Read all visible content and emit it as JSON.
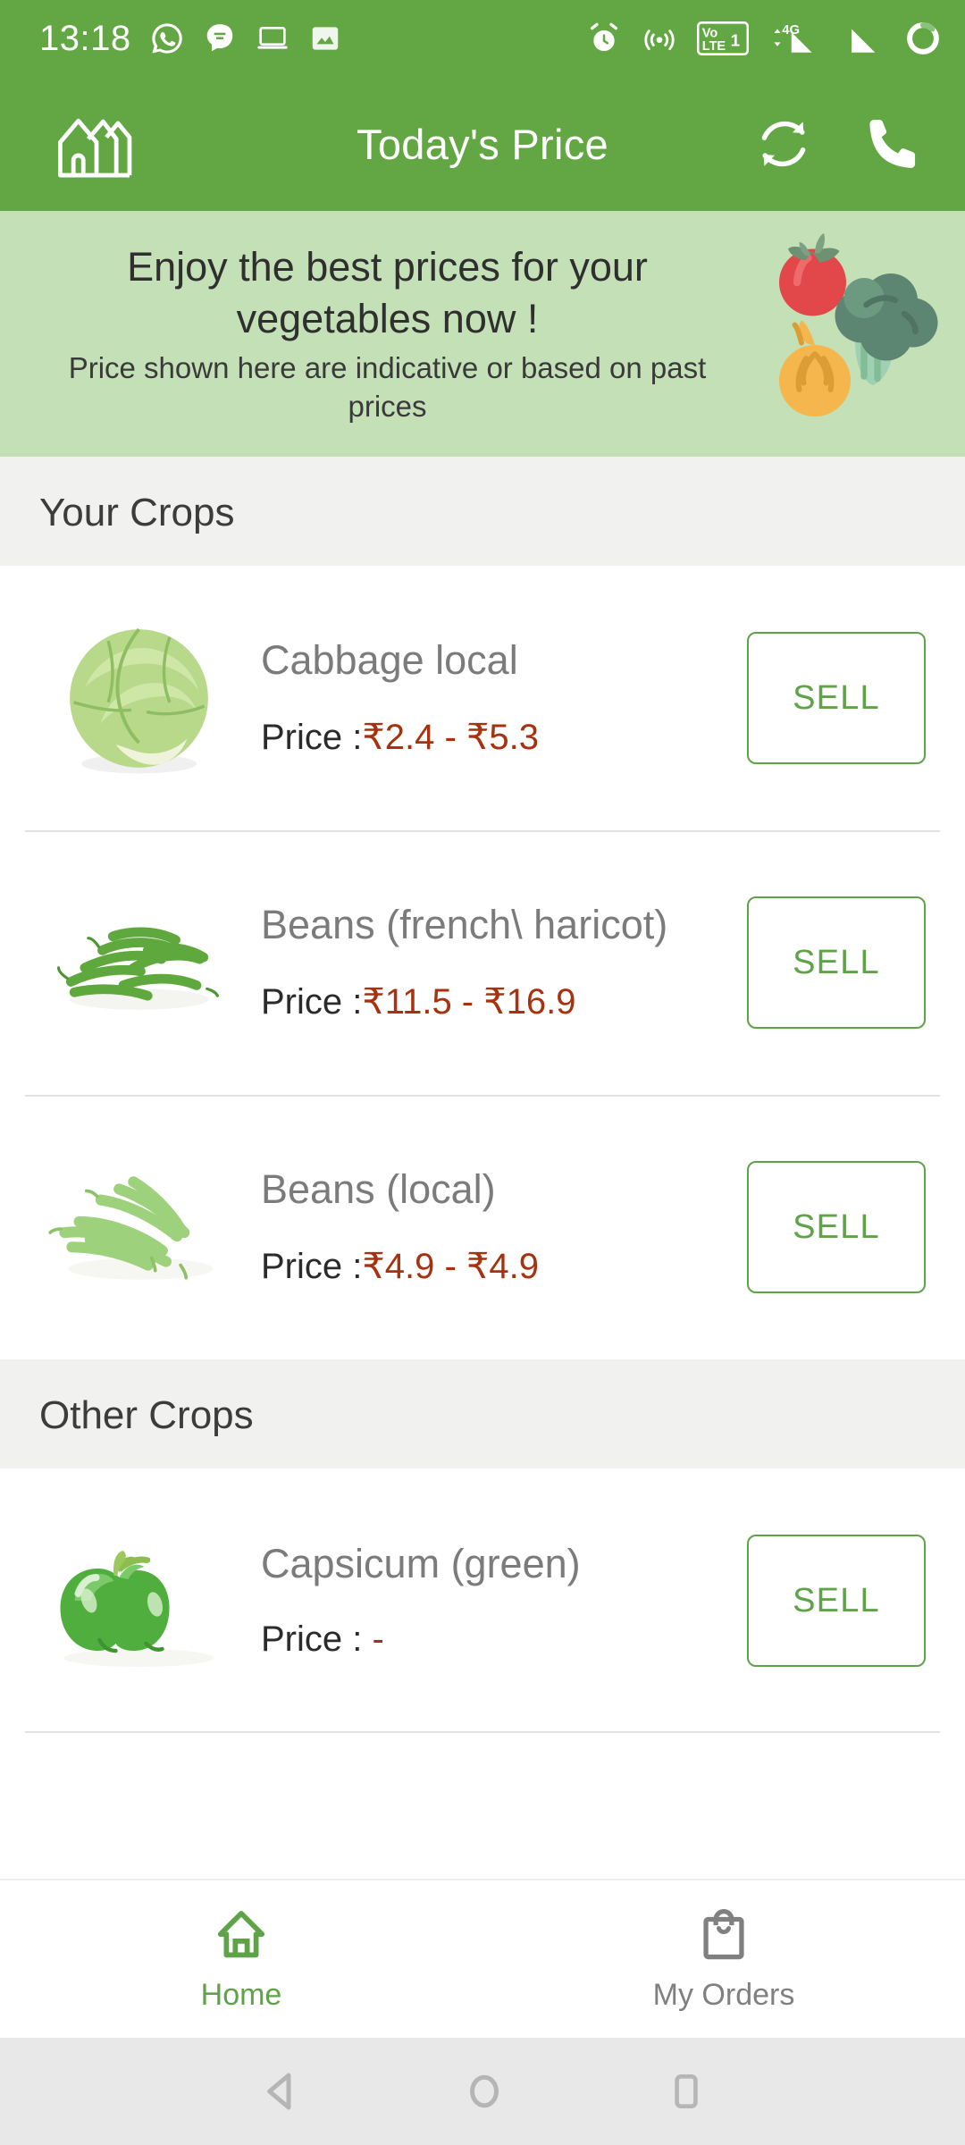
{
  "status_bar": {
    "time": "13:18",
    "left_icons": [
      "whatsapp-icon",
      "chat-bubble-icon",
      "laptop-icon",
      "image-icon"
    ],
    "right_icons": [
      "alarm-icon",
      "cast-icon",
      "volte-1-icon",
      "signal-4g-icon",
      "signal-icon",
      "battery-icon"
    ],
    "volte_label": "Vo",
    "lte_label": "LTE",
    "sim_label": "1",
    "network_label": "4G",
    "background_color": "#62a744"
  },
  "app_bar": {
    "title": "Today's Price",
    "logo_icon": "farmhouse-logo-icon",
    "refresh_icon": "refresh-icon",
    "call_icon": "phone-icon",
    "background_color": "#62a744"
  },
  "banner": {
    "headline": "Enjoy the best prices for your vegetables now !",
    "subtext": "Price shown here are indicative or based on past prices",
    "art_icon": "vegetables-illustration",
    "background_color": "#c4e0b6"
  },
  "sections": [
    {
      "id": "your-crops",
      "title": "Your Crops",
      "crops": [
        {
          "name": "Cabbage local",
          "price_label": "Price :",
          "price_value": "₹2.4 - ₹5.3",
          "sell_label": "SELL",
          "image": "cabbage-image"
        },
        {
          "name": "Beans (french\\ haricot)",
          "price_label": "Price :",
          "price_value": "₹11.5 - ₹16.9",
          "sell_label": "SELL",
          "image": "french-beans-image"
        },
        {
          "name": "Beans (local)",
          "price_label": "Price :",
          "price_value": "₹4.9 - ₹4.9",
          "sell_label": "SELL",
          "image": "local-beans-image"
        }
      ]
    },
    {
      "id": "other-crops",
      "title": "Other Crops",
      "crops": [
        {
          "name": "Capsicum (green)",
          "price_label": "Price : ",
          "price_value": "-",
          "sell_label": "SELL",
          "image": "green-capsicum-image"
        }
      ]
    }
  ],
  "bottom_nav": {
    "items": [
      {
        "label": "Home",
        "icon": "home-icon",
        "active": true
      },
      {
        "label": "My Orders",
        "icon": "shopping-bag-icon",
        "active": false
      }
    ],
    "active_color": "#5fa349",
    "inactive_color": "#808080"
  },
  "android_nav": {
    "back_icon": "back-triangle-icon",
    "home_icon": "home-circle-icon",
    "recents_icon": "recents-square-icon"
  },
  "theme": {
    "primary": "#62a744",
    "banner_bg": "#c4e0b6",
    "section_bg": "#f1f1ef",
    "price_color": "#a6320f",
    "sell_border": "#5fa349"
  }
}
